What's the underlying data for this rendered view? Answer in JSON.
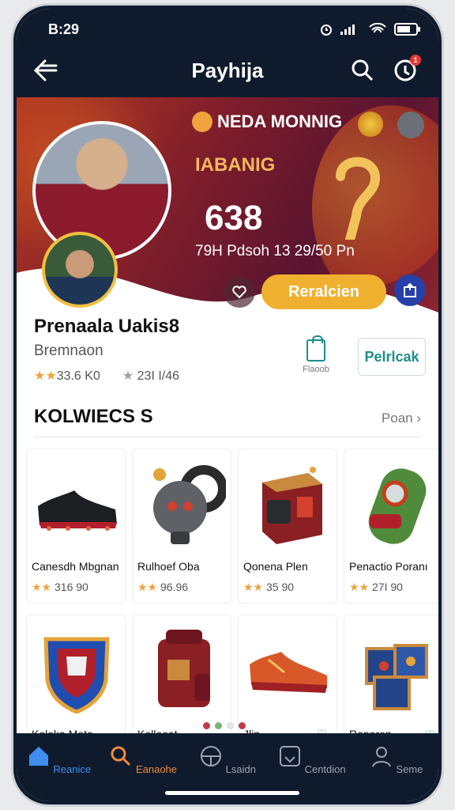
{
  "status": {
    "time": "B:29"
  },
  "appbar": {
    "title": "Payhija",
    "notif_count": "1"
  },
  "hero": {
    "badge": "NEDA MONNIG",
    "subtitle": "IABANIG",
    "big_number": "638",
    "stats": "79H Pdsoh 13  29/50 Pn",
    "primary_button": "Reralcien"
  },
  "profile": {
    "name": "Prenaala Uakis8",
    "role": "Bremnaon",
    "stat1": "33.6 K0",
    "stat2": "23I I/46",
    "bag_label": "Flaoob",
    "action_button": "Pelrlcak"
  },
  "section": {
    "title": "KOLWIECS S",
    "link": "Poan"
  },
  "items": [
    {
      "name": "Canesdh Mbgnan",
      "rating": "316 90"
    },
    {
      "name": "Rulhoef Oba",
      "rating": "96.96"
    },
    {
      "name": "Qonena Plen",
      "rating": "35 90"
    },
    {
      "name": "Penactio Poranı",
      "rating": "27I 90"
    },
    {
      "name": "Koleka Mete"
    },
    {
      "name": "Kolleoat"
    },
    {
      "name": "Jlin"
    },
    {
      "name": "Raneren"
    }
  ],
  "nav": [
    {
      "label": "Reanice",
      "icon": "home-icon"
    },
    {
      "label": "Eanaohe",
      "icon": "search-icon"
    },
    {
      "label": "Lsaidn",
      "icon": "steering-icon"
    },
    {
      "label": "Centdion",
      "icon": "calendar-icon"
    },
    {
      "label": "Seme",
      "icon": "user-icon"
    }
  ],
  "colors": {
    "dark": "#0f1b2d",
    "accent": "#f0b02f",
    "teal": "#1e8e8a",
    "nav_active": "#3f8ef0"
  }
}
